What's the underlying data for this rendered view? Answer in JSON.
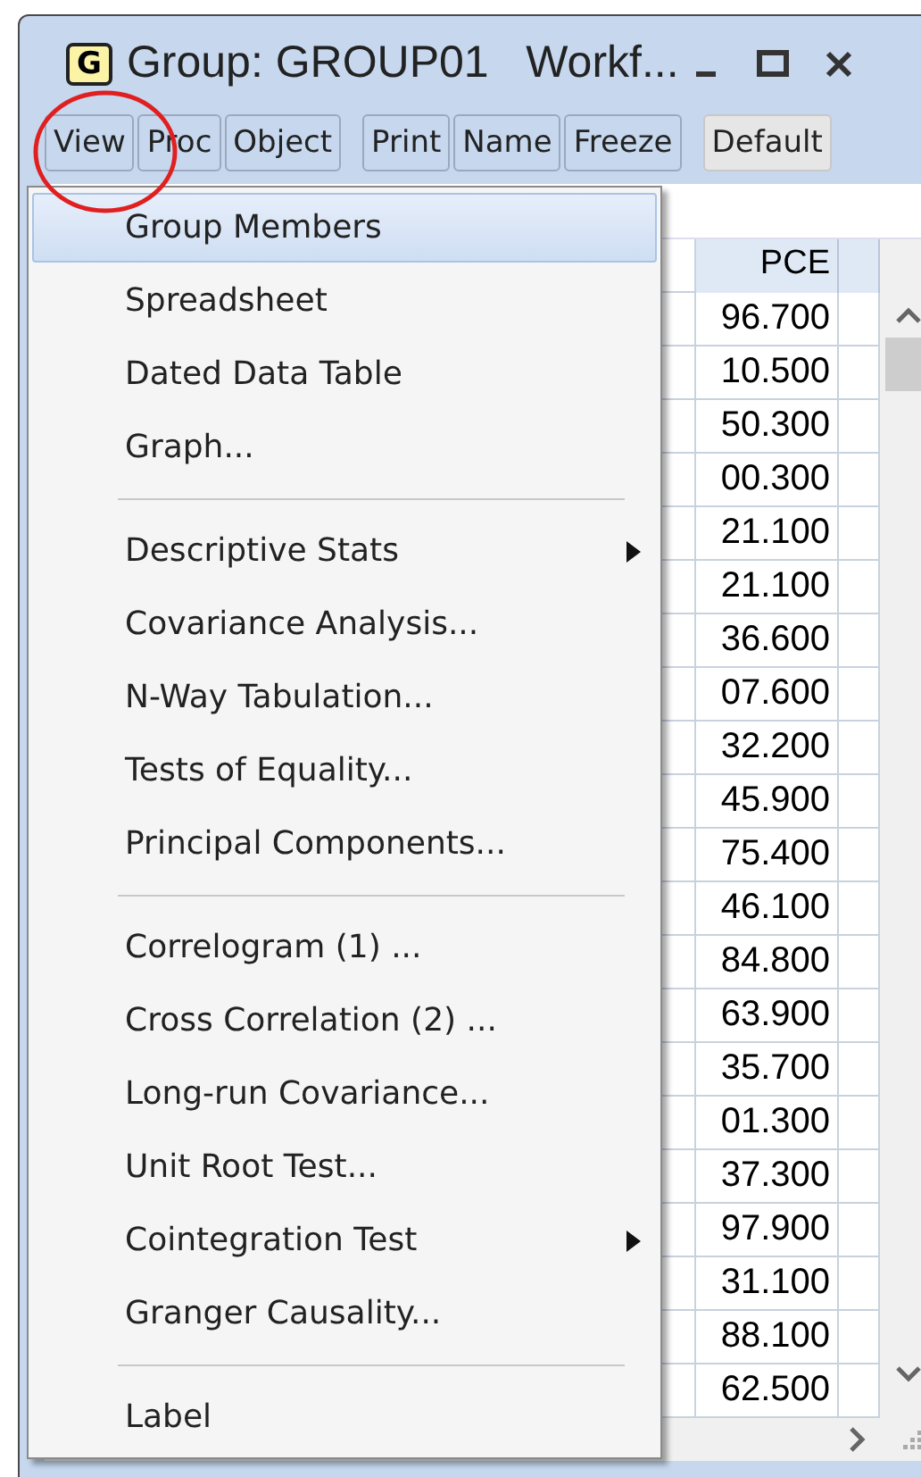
{
  "window": {
    "badge": "G",
    "title": "Group: GROUP01   Workf..."
  },
  "toolbar": [
    {
      "label": "View"
    },
    {
      "label": "Proc"
    },
    {
      "label": "Object"
    },
    {
      "label": "Print"
    },
    {
      "label": "Name"
    },
    {
      "label": "Freeze"
    },
    {
      "label": "Default"
    }
  ],
  "grid": {
    "column": "PCE",
    "values": [
      "96.700",
      "10.500",
      "50.300",
      "00.300",
      "21.100",
      "21.100",
      "36.600",
      "07.600",
      "32.200",
      "45.900",
      "75.400",
      "46.100",
      "84.800",
      "63.900",
      "35.700",
      "01.300",
      "37.300",
      "97.900",
      "31.100",
      "88.100",
      "62.500"
    ]
  },
  "menu": [
    {
      "kind": "item",
      "label": "Group Members",
      "selected": true,
      "submenu": false
    },
    {
      "kind": "item",
      "label": "Spreadsheet",
      "selected": false,
      "submenu": false
    },
    {
      "kind": "item",
      "label": "Dated Data Table",
      "selected": false,
      "submenu": false
    },
    {
      "kind": "item",
      "label": "Graph...",
      "selected": false,
      "submenu": false
    },
    {
      "kind": "separator"
    },
    {
      "kind": "item",
      "label": "Descriptive Stats",
      "selected": false,
      "submenu": true
    },
    {
      "kind": "item",
      "label": "Covariance Analysis...",
      "selected": false,
      "submenu": false
    },
    {
      "kind": "item",
      "label": "N-Way Tabulation...",
      "selected": false,
      "submenu": false
    },
    {
      "kind": "item",
      "label": "Tests of Equality...",
      "selected": false,
      "submenu": false
    },
    {
      "kind": "item",
      "label": "Principal Components...",
      "selected": false,
      "submenu": false
    },
    {
      "kind": "separator"
    },
    {
      "kind": "item",
      "label": "Correlogram (1) ...",
      "selected": false,
      "submenu": false
    },
    {
      "kind": "item",
      "label": "Cross Correlation (2) ...",
      "selected": false,
      "submenu": false
    },
    {
      "kind": "item",
      "label": "Long-run Covariance...",
      "selected": false,
      "submenu": false
    },
    {
      "kind": "item",
      "label": "Unit Root Test...",
      "selected": false,
      "submenu": false
    },
    {
      "kind": "item",
      "label": "Cointegration Test",
      "selected": false,
      "submenu": true
    },
    {
      "kind": "item",
      "label": "Granger Causality...",
      "selected": false,
      "submenu": false
    },
    {
      "kind": "separator"
    },
    {
      "kind": "item",
      "label": "Label",
      "selected": false,
      "submenu": false
    }
  ]
}
